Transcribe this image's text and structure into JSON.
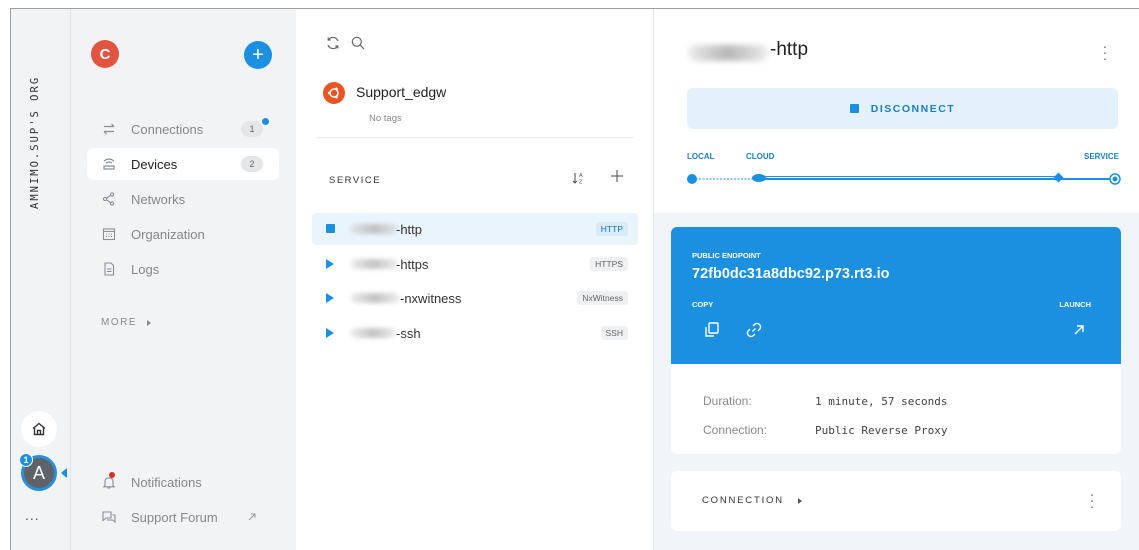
{
  "rail": {
    "org_label": "AMNIMO.SUP'S ORG",
    "account_initial": "A",
    "account_badge": "1",
    "more": "..."
  },
  "nav": {
    "org_initial": "C",
    "add": "+",
    "items": [
      {
        "label": "Connections",
        "icon": "swap-arrows-icon",
        "count": "1"
      },
      {
        "label": "Devices",
        "icon": "router-icon",
        "count": "2"
      },
      {
        "label": "Networks",
        "icon": "network-icon"
      },
      {
        "label": "Organization",
        "icon": "organization-icon"
      },
      {
        "label": "Logs",
        "icon": "document-icon"
      }
    ],
    "more_label": "MORE",
    "footer": [
      {
        "label": "Notifications",
        "icon": "bell-icon"
      },
      {
        "label": "Support Forum",
        "icon": "forum-icon"
      }
    ]
  },
  "list": {
    "device_name": "Support_edgw",
    "device_tags": "No tags",
    "section_title": "SERVICE",
    "services": [
      {
        "name": "-http",
        "tag": "HTTP",
        "state": "connected"
      },
      {
        "name": "-https",
        "tag": "HTTPS",
        "state": "idle"
      },
      {
        "name": "-nxwitness",
        "tag": "NxWitness",
        "state": "idle"
      },
      {
        "name": "-ssh",
        "tag": "SSH",
        "state": "idle"
      }
    ]
  },
  "detail": {
    "title": "-http",
    "disconnect_label": "DISCONNECT",
    "route": {
      "local": "LOCAL",
      "cloud": "CLOUD",
      "service": "SERVICE"
    },
    "endpoint": {
      "label": "PUBLIC ENDPOINT",
      "value": "72fb0dc31a8dbc92.p73.rt3.io",
      "copy_label": "COPY",
      "launch_label": "LAUNCH"
    },
    "info": [
      {
        "label": "Duration:",
        "value": "1 minute, 57 seconds"
      },
      {
        "label": "Connection:",
        "value": "Public Reverse Proxy"
      }
    ],
    "connection_section": "CONNECTION"
  },
  "colors": {
    "accent": "#1b90e0",
    "org_avatar": "#e2543f",
    "ubuntu": "#e95420"
  }
}
